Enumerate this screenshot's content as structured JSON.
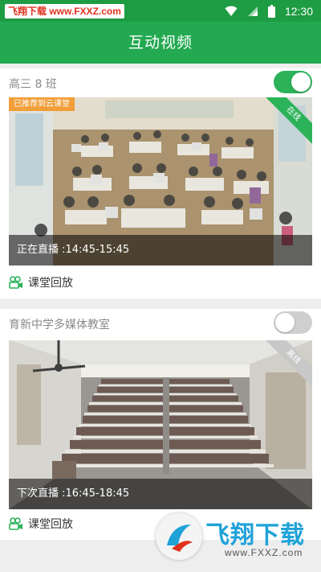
{
  "status_bar": {
    "watermark": "飞翔下载 www.FXXZ.com",
    "time": "12:30"
  },
  "app_bar": {
    "title": "互动视频"
  },
  "classrooms": [
    {
      "name": "高三 8 班",
      "enabled": true,
      "recommend_badge": "已推荐到云课堂",
      "status_ribbon": "在线",
      "schedule": "正在直播 :14:45-15:45",
      "replay_label": "课堂回放"
    },
    {
      "name": "育新中学多媒体教室",
      "enabled": false,
      "status_ribbon": "离线",
      "schedule": "下次直播 :16:45-18:45",
      "replay_label": "课堂回放"
    }
  ],
  "footer_watermark": {
    "brand": "飞翔下载",
    "url": "www.FXXZ.com"
  },
  "colors": {
    "accent": "#23a951",
    "statusbar": "#1e9c43",
    "toggle_on": "#2cb35a",
    "badge": "#f19e38"
  }
}
